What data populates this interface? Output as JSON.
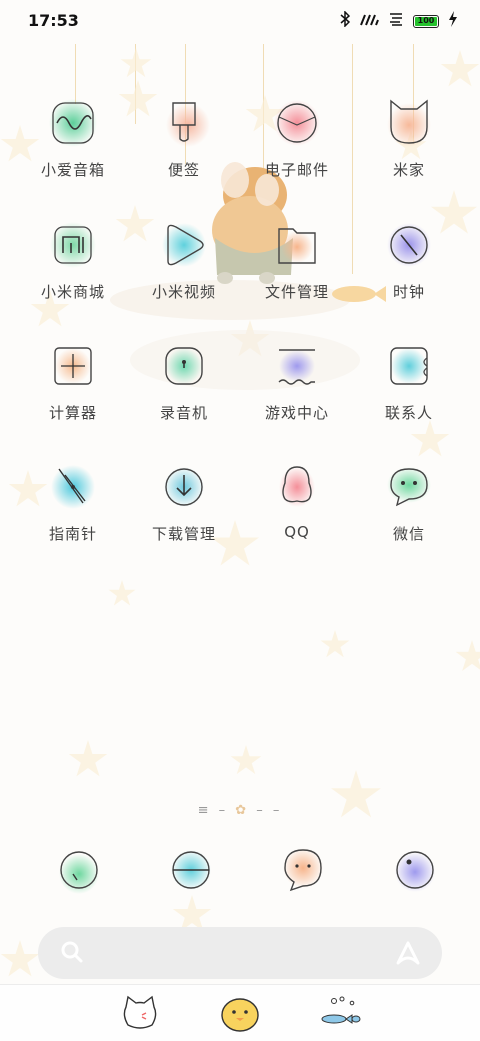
{
  "status": {
    "time": "17:53",
    "battery": "100",
    "icons": [
      "bluetooth-icon",
      "signal-icon",
      "wifi-icon",
      "battery-icon",
      "charging-icon"
    ]
  },
  "apps": [
    {
      "label": "小爱音箱",
      "icon": "xiaoai-speaker-icon",
      "color": "#5ccf9a"
    },
    {
      "label": "便签",
      "icon": "notes-icon",
      "color": "#f6b7a0"
    },
    {
      "label": "电子邮件",
      "icon": "email-icon",
      "color": "#f48f99"
    },
    {
      "label": "米家",
      "icon": "mijia-icon",
      "color": "#f7b99a"
    },
    {
      "label": "小米商城",
      "icon": "mi-store-icon",
      "color": "#7fd8a8"
    },
    {
      "label": "小米视频",
      "icon": "mi-video-icon",
      "color": "#5fd1dd"
    },
    {
      "label": "文件管理",
      "icon": "file-manager-icon",
      "color": "#f7b58c"
    },
    {
      "label": "时钟",
      "icon": "clock-icon",
      "color": "#9b93ea"
    },
    {
      "label": "计算器",
      "icon": "calculator-icon",
      "color": "#f6bb90"
    },
    {
      "label": "录音机",
      "icon": "recorder-icon",
      "color": "#6fd8b0"
    },
    {
      "label": "游戏中心",
      "icon": "game-center-icon",
      "color": "#9f9aee"
    },
    {
      "label": "联系人",
      "icon": "contacts-icon",
      "color": "#5fcfdc"
    },
    {
      "label": "指南针",
      "icon": "compass-icon",
      "color": "#4fc9dd"
    },
    {
      "label": "下载管理",
      "icon": "download-icon",
      "color": "#6fc9de"
    },
    {
      "label": "QQ",
      "icon": "qq-icon",
      "color": "#f48f99"
    },
    {
      "label": "微信",
      "icon": "wechat-icon",
      "color": "#6fd8a0"
    }
  ],
  "pager": {
    "left": "≡ –",
    "current": "✿",
    "right": "– –"
  },
  "dock": [
    {
      "icon": "phone-icon",
      "color": "#6fd8a0"
    },
    {
      "icon": "browser-icon",
      "color": "#5fcfdc"
    },
    {
      "icon": "messages-icon",
      "color": "#f7b58c"
    },
    {
      "icon": "camera-icon",
      "color": "#9f9aee"
    }
  ],
  "search": {
    "icon": "search-icon",
    "assistant_icon": "xiaoai-assistant-icon"
  },
  "nav": [
    {
      "icon": "cat-mascot-icon"
    },
    {
      "icon": "chick-mascot-icon"
    },
    {
      "icon": "fish-icon"
    }
  ]
}
